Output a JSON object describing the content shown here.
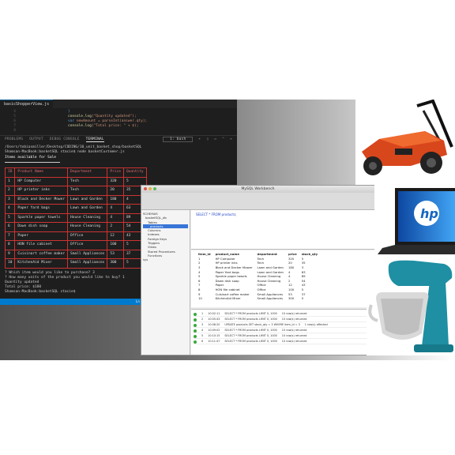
{
  "vscode": {
    "tab_label": "basicShopperView.js",
    "panel_tabs": [
      "PROBLEMS",
      "OUTPUT",
      "DEBUG CONSOLE",
      "TERMINAL"
    ],
    "terminal_select": "1: bash",
    "prompt_line1": "/Users/tobiasmiller/Desktop/CODING/10_unit_basket_shop/basketSQL",
    "prompt_line2": "Shamsan-MacBook:basketSQL stacie$ node basketCustomer.js",
    "heading": "Items available for Sale",
    "columns": [
      "ID",
      "Product Name",
      "Department",
      "Price",
      "Quantity"
    ],
    "rows": [
      [
        "1",
        "HP Computer",
        "Tech",
        "320",
        "5"
      ],
      [
        "2",
        "HP printer inks",
        "Tech",
        "20",
        "35"
      ],
      [
        "3",
        "Black and Decker Mower",
        "Lawn and Garden",
        "180",
        "4"
      ],
      [
        "4",
        "Paper Yard bags",
        "Lawn and Garden",
        "4",
        "63"
      ],
      [
        "5",
        "Sparkle paper towels",
        "House Cleaning",
        "4",
        "89"
      ],
      [
        "6",
        "Dawn dish soap",
        "House Cleaning",
        "2",
        "54"
      ],
      [
        "7",
        "Paper",
        "Office",
        "12",
        "43"
      ],
      [
        "8",
        "HON file cabinet",
        "Office",
        "100",
        "5"
      ],
      [
        "9",
        "Cuisinart coffee maker",
        "Small Appliances",
        "53",
        "37"
      ],
      [
        "10",
        "KitchenAid Mixer",
        "Small Appliances",
        "300",
        "5"
      ]
    ],
    "question1": "? Which item would you like to purchase? 3",
    "question2": "? How many units of the product you would like to buy? 1",
    "result_line": "Quantity updated",
    "total_line": "Total price: $180",
    "final_prompt": "Shamsan-MacBook:basketSQL stacie$",
    "status": "Ln 17, Col 1"
  },
  "dbwin": {
    "title": "MySQL Workbench",
    "query": "SELECT * FROM products;",
    "sidebar": [
      "SCHEMAS",
      "basketSQL_db",
      "Tables",
      "products",
      "Columns",
      "Indexes",
      "Foreign Keys",
      "Triggers",
      "Views",
      "Stored Procedures",
      "Functions",
      "sys"
    ],
    "result_cols": [
      "item_id",
      "product_name",
      "department",
      "price",
      "stock_qty"
    ],
    "result_rows": [
      [
        "1",
        "HP Computer",
        "Tech",
        "320",
        "5"
      ],
      [
        "2",
        "HP printer inks",
        "Tech",
        "20",
        "35"
      ],
      [
        "3",
        "Black and Decker Mower",
        "Lawn and Garden",
        "180",
        "3"
      ],
      [
        "4",
        "Paper Yard bags",
        "Lawn and Garden",
        "4",
        "63"
      ],
      [
        "5",
        "Sparkle paper towels",
        "House Cleaning",
        "4",
        "89"
      ],
      [
        "6",
        "Dawn dish soap",
        "House Cleaning",
        "2",
        "54"
      ],
      [
        "7",
        "Paper",
        "Office",
        "12",
        "43"
      ],
      [
        "8",
        "HON file cabinet",
        "Office",
        "100",
        "5"
      ],
      [
        "9",
        "Cuisinart coffee maker",
        "Small Appliances",
        "53",
        "37"
      ],
      [
        "10",
        "KitchenAid Mixer",
        "Small Appliances",
        "300",
        "5"
      ]
    ],
    "log_rows": [
      [
        "1",
        "10:02:11",
        "SELECT * FROM products LIMIT 0, 1000",
        "10 row(s) returned"
      ],
      [
        "2",
        "10:05:43",
        "SELECT * FROM products LIMIT 0, 1000",
        "10 row(s) returned"
      ],
      [
        "3",
        "10:08:20",
        "UPDATE products SET stock_qty = 3 WHERE item_id = 3",
        "1 row(s) affected"
      ],
      [
        "4",
        "10:09:02",
        "SELECT * FROM products LIMIT 0, 1000",
        "10 row(s) returned"
      ],
      [
        "5",
        "10:10:15",
        "SELECT * FROM products LIMIT 0, 1000",
        "10 row(s) returned"
      ],
      [
        "6",
        "10:11:47",
        "SELECT * FROM products LIMIT 0, 1000",
        "10 row(s) returned"
      ]
    ]
  },
  "products": {
    "laptop_logo": "hp"
  }
}
